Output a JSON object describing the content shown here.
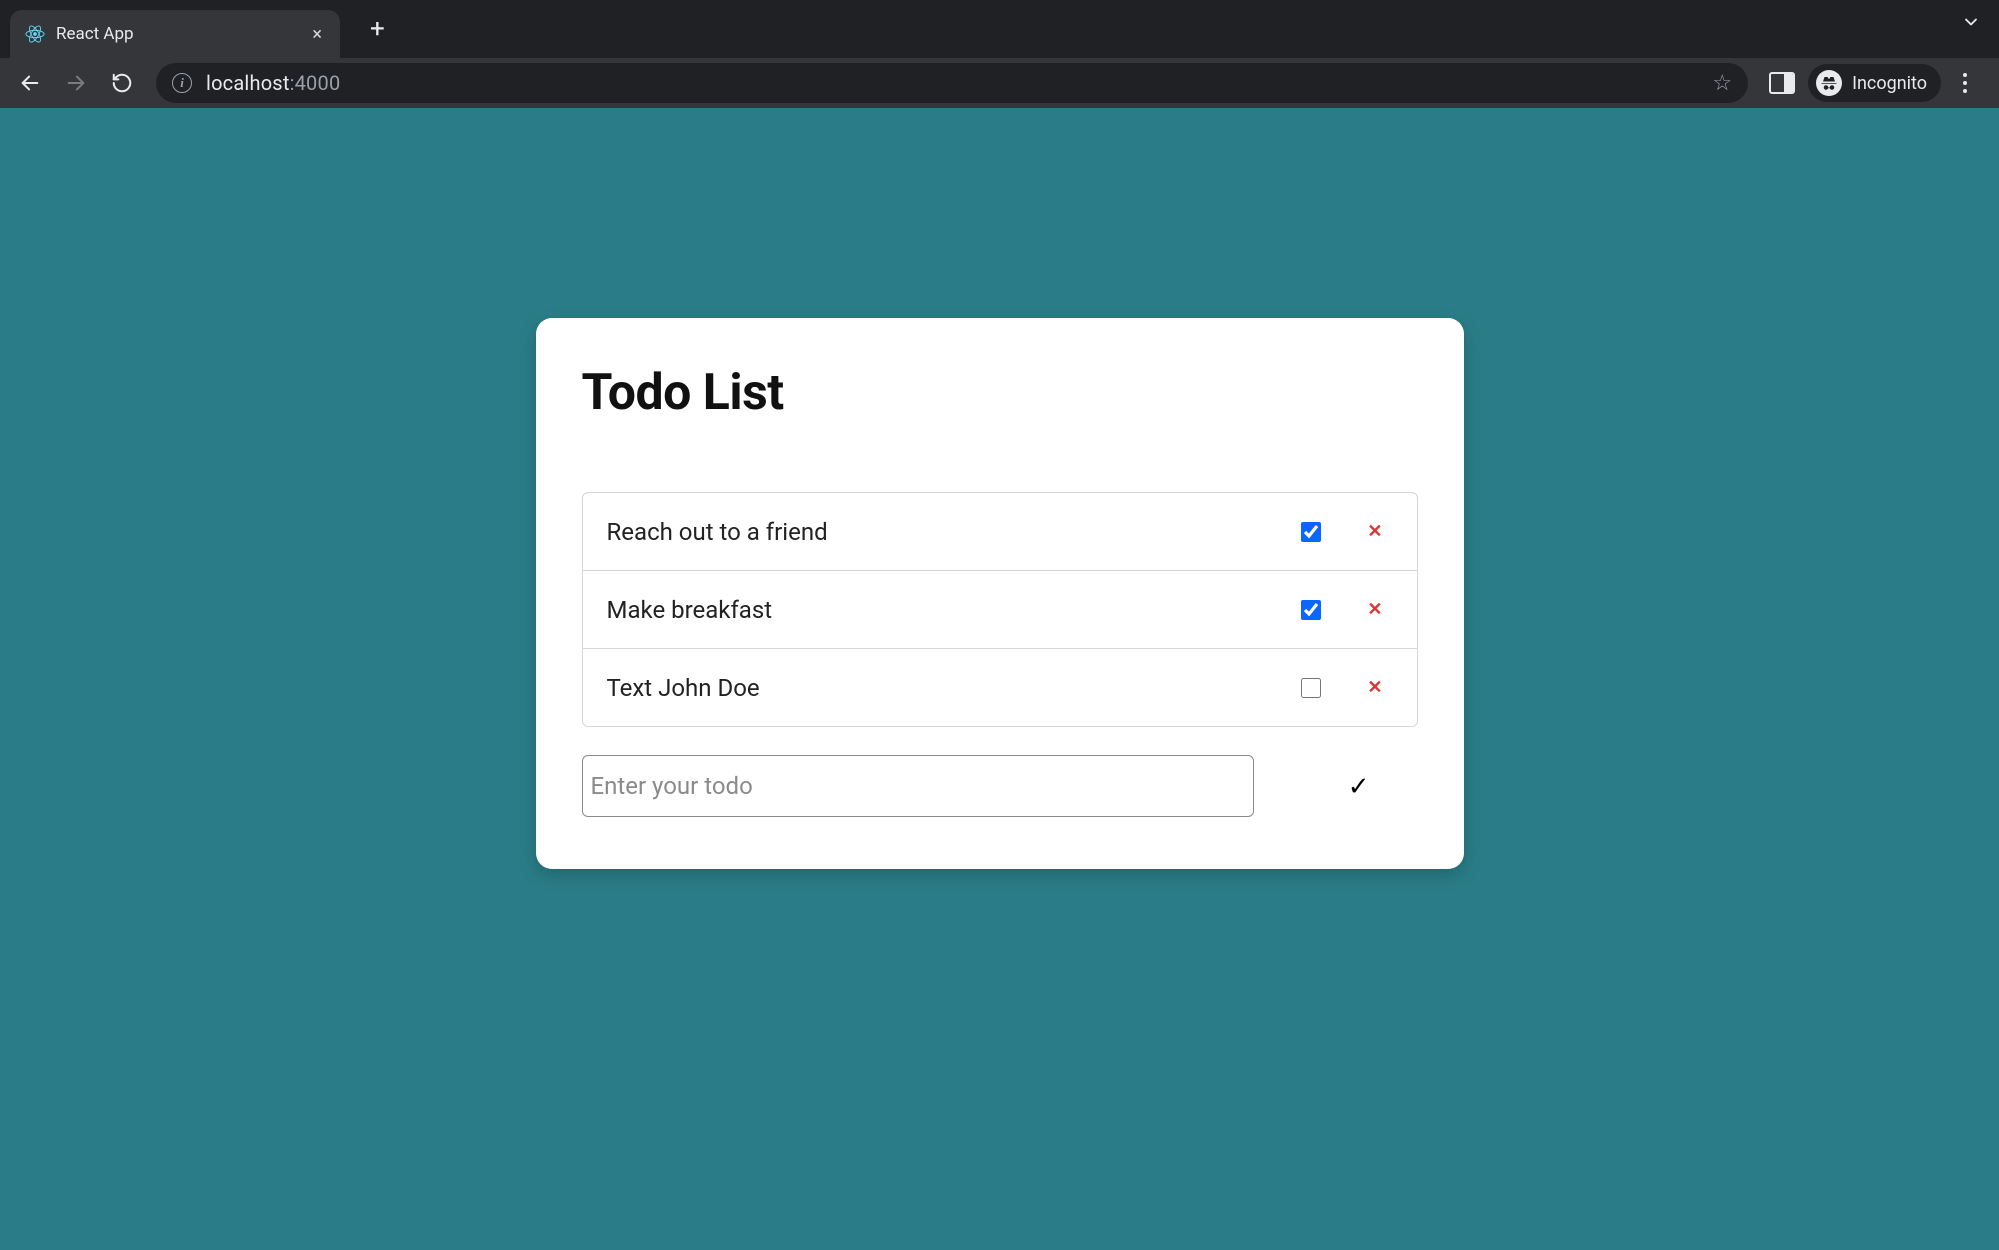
{
  "browser": {
    "tab_title": "React App",
    "url_host": "localhost",
    "url_port": ":4000",
    "incognito_label": "Incognito"
  },
  "page": {
    "title": "Todo List",
    "todos": [
      {
        "text": "Reach out to a friend",
        "checked": true
      },
      {
        "text": "Make breakfast",
        "checked": true
      },
      {
        "text": "Text John Doe",
        "checked": false
      }
    ],
    "input": {
      "placeholder": "Enter your todo",
      "value": ""
    }
  },
  "icons": {
    "close_glyph": "×",
    "plus_glyph": "+",
    "star_glyph": "☆",
    "check_glyph": "✓",
    "delete_glyph": "✕"
  }
}
